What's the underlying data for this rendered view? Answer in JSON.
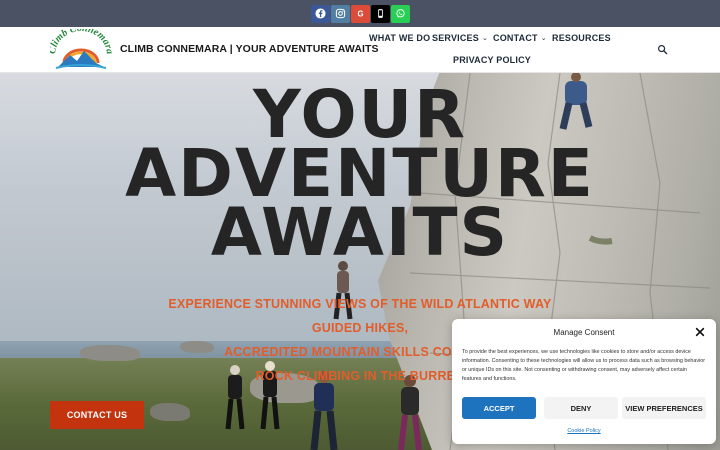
{
  "social": [
    {
      "name": "facebook",
      "color": "#3b5998"
    },
    {
      "name": "instagram",
      "color": "#517fa4"
    },
    {
      "name": "google",
      "color": "#dd4b39"
    },
    {
      "name": "phone",
      "color": "#000000"
    },
    {
      "name": "whatsapp",
      "color": "#28cf54"
    }
  ],
  "header": {
    "logo_text": "Climb Connemara",
    "site_title": "CLIMB CONNEMARA | YOUR ADVENTURE AWAITS",
    "nav": [
      {
        "label": "WHAT WE DO",
        "has_dropdown": false
      },
      {
        "label": "SERVICES",
        "has_dropdown": true
      },
      {
        "label": "CONTACT",
        "has_dropdown": true
      },
      {
        "label": "RESOURCES",
        "has_dropdown": false
      },
      {
        "label": "PRIVACY POLICY",
        "has_dropdown": false
      }
    ]
  },
  "hero": {
    "title_lines": [
      "YOUR",
      "ADVENTURE",
      "AWAITS"
    ],
    "taglines": [
      "EXPERIENCE STUNNING VIEWS OF THE WILD ATLANTIC WAY",
      "GUIDED HIKES,",
      "ACCREDITED MOUNTAIN SKILLS COURSES",
      "ROCK CLIMBING IN THE BURREN"
    ],
    "cta_label": "CONTACT US"
  },
  "consent": {
    "title": "Manage Consent",
    "body": "To provide the best experiences, we use technologies like cookies to store and/or access device information. Consenting to these technologies will allow us to process data such as browsing behavior or unique IDs on this site. Not consenting or withdrawing consent, may adversely affect certain features and functions.",
    "accept_label": "ACCEPT",
    "deny_label": "DENY",
    "preferences_label": "VIEW PREFERENCES",
    "policy_link": "Cookie Policy"
  },
  "colors": {
    "topbar": "#4a5263",
    "accent": "#e35d2b",
    "cta": "#c3330d",
    "accept": "#1e73be"
  }
}
